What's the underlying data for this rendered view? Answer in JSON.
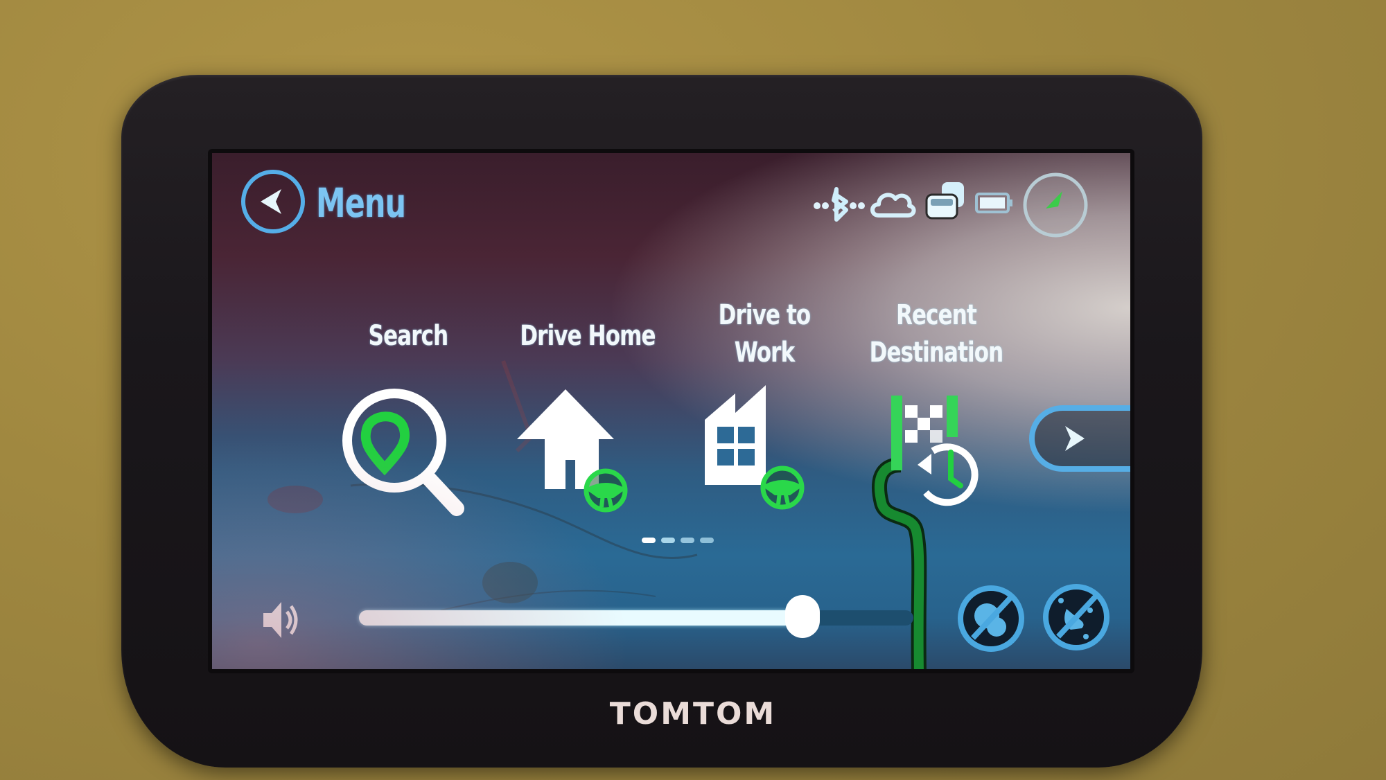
{
  "header": {
    "back_label": "Menu",
    "status_icons": [
      "bluetooth-icon",
      "cloud-icon",
      "traffic-icon",
      "battery-icon"
    ],
    "compass_label": "current-position"
  },
  "main_menu": {
    "items": [
      {
        "label_line1": "Search",
        "label_line2": "",
        "icon": "search-pin-icon"
      },
      {
        "label_line1": "Drive Home",
        "label_line2": "",
        "icon": "home-drive-icon"
      },
      {
        "label_line1": "Drive to",
        "label_line2": "Work",
        "icon": "work-drive-icon"
      },
      {
        "label_line1": "Recent",
        "label_line2": "Destination",
        "icon": "recent-destination-icon"
      }
    ],
    "page_indicator": {
      "current": 1,
      "total": 4
    }
  },
  "bottom_bar": {
    "volume_level": 0.8,
    "buttons": [
      "no-traffic-icon",
      "no-sound-icon"
    ]
  },
  "device": {
    "brand": "TOMTOM"
  },
  "colors": {
    "accent_blue": "#4aa8e0",
    "accent_green": "#22d040",
    "route_green": "#127a28",
    "label_white": "#f2f8fb"
  }
}
